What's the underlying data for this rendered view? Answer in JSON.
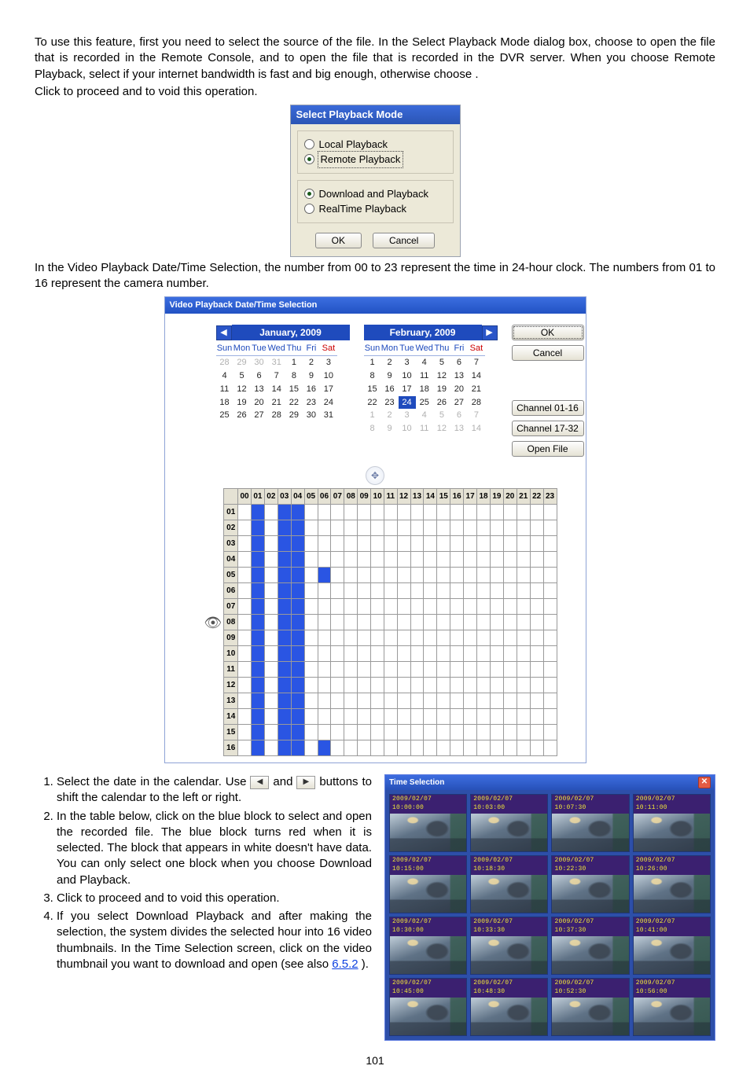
{
  "intro": {
    "p1a": "To use this feature, first you need to select the source of the file. In the Select Playback Mode dialog box, choose ",
    "p1b": " to open the file that is recorded in the Remote Console, and ",
    "p1c": " to open the file that is recorded in the DVR server. When you choose Remote Playback, select ",
    "p1d": " if your internet bandwidth is fast and big enough, otherwise choose ",
    "p1e": ".",
    "p2a": "Click ",
    "p2b": " to proceed and ",
    "p2c": " to void this operation."
  },
  "spm": {
    "title": "Select Playback Mode",
    "opt1": "Local Playback",
    "opt2": "Remote Playback",
    "opt3": "Download and Playback",
    "opt4": "RealTime Playback",
    "ok": "OK",
    "cancel": "Cancel"
  },
  "mid": {
    "p": "In the Video Playback Date/Time Selection, the number from 00 to 23 represent the time in 24-hour clock. The numbers from 01 to 16 represent the camera number."
  },
  "vpd": {
    "title": "Video Playback Date/Time Selection",
    "ok": "OK",
    "cancel": "Cancel",
    "ch1": "Channel 01-16",
    "ch2": "Channel 17-32",
    "open": "Open File",
    "months": [
      {
        "label": "January, 2009",
        "dow": [
          "Sun",
          "Mon",
          "Tue",
          "Wed",
          "Thu",
          "Fri",
          "Sat"
        ],
        "weeks": [
          [
            {
              "d": 28,
              "dim": true
            },
            {
              "d": 29,
              "dim": true
            },
            {
              "d": 30,
              "dim": true
            },
            {
              "d": 31,
              "dim": true
            },
            {
              "d": 1
            },
            {
              "d": 2
            },
            {
              "d": 3
            }
          ],
          [
            {
              "d": 4
            },
            {
              "d": 5
            },
            {
              "d": 6
            },
            {
              "d": 7
            },
            {
              "d": 8
            },
            {
              "d": 9
            },
            {
              "d": 10
            }
          ],
          [
            {
              "d": 11
            },
            {
              "d": 12
            },
            {
              "d": 13
            },
            {
              "d": 14
            },
            {
              "d": 15
            },
            {
              "d": 16
            },
            {
              "d": 17
            }
          ],
          [
            {
              "d": 18
            },
            {
              "d": 19
            },
            {
              "d": 20
            },
            {
              "d": 21
            },
            {
              "d": 22
            },
            {
              "d": 23
            },
            {
              "d": 24
            }
          ],
          [
            {
              "d": 25
            },
            {
              "d": 26
            },
            {
              "d": 27
            },
            {
              "d": 28
            },
            {
              "d": 29
            },
            {
              "d": 30
            },
            {
              "d": 31
            }
          ]
        ]
      },
      {
        "label": "February, 2009",
        "dow": [
          "Sun",
          "Mon",
          "Tue",
          "Wed",
          "Thu",
          "Fri",
          "Sat"
        ],
        "weeks": [
          [
            {
              "d": 1
            },
            {
              "d": 2
            },
            {
              "d": 3
            },
            {
              "d": 4
            },
            {
              "d": 5
            },
            {
              "d": 6
            },
            {
              "d": 7
            }
          ],
          [
            {
              "d": 8
            },
            {
              "d": 9
            },
            {
              "d": 10
            },
            {
              "d": 11
            },
            {
              "d": 12
            },
            {
              "d": 13
            },
            {
              "d": 14
            }
          ],
          [
            {
              "d": 15
            },
            {
              "d": 16
            },
            {
              "d": 17
            },
            {
              "d": 18
            },
            {
              "d": 19
            },
            {
              "d": 20
            },
            {
              "d": 21
            }
          ],
          [
            {
              "d": 22
            },
            {
              "d": 23
            },
            {
              "d": 24,
              "sel": true
            },
            {
              "d": 25
            },
            {
              "d": 26
            },
            {
              "d": 27
            },
            {
              "d": 28
            }
          ],
          [
            {
              "d": 1,
              "dim": true
            },
            {
              "d": 2,
              "dim": true
            },
            {
              "d": 3,
              "dim": true
            },
            {
              "d": 4,
              "dim": true
            },
            {
              "d": 5,
              "dim": true
            },
            {
              "d": 6,
              "dim": true
            },
            {
              "d": 7,
              "dim": true
            }
          ],
          [
            {
              "d": 8,
              "dim": true
            },
            {
              "d": 9,
              "dim": true
            },
            {
              "d": 10,
              "dim": true
            },
            {
              "d": 11,
              "dim": true
            },
            {
              "d": 12,
              "dim": true
            },
            {
              "d": 13,
              "dim": true
            },
            {
              "d": 14,
              "dim": true
            }
          ]
        ]
      }
    ],
    "hours": [
      "00",
      "01",
      "02",
      "03",
      "04",
      "05",
      "06",
      "07",
      "08",
      "09",
      "10",
      "11",
      "12",
      "13",
      "14",
      "15",
      "16",
      "17",
      "18",
      "19",
      "20",
      "21",
      "22",
      "23"
    ],
    "rows": [
      "01",
      "02",
      "03",
      "04",
      "05",
      "06",
      "07",
      "08",
      "09",
      "10",
      "11",
      "12",
      "13",
      "14",
      "15",
      "16"
    ],
    "on_cells": {
      "01": [
        1,
        3,
        4
      ],
      "02": [
        1,
        3,
        4
      ],
      "03": [
        1,
        3,
        4
      ],
      "04": [
        1,
        3,
        4
      ],
      "05": [
        1,
        3,
        4,
        6
      ],
      "06": [
        1,
        3,
        4
      ],
      "07": [
        1,
        3,
        4
      ],
      "08": [
        1,
        3,
        4
      ],
      "09": [
        1,
        3,
        4
      ],
      "10": [
        1,
        3,
        4
      ],
      "11": [
        1,
        3,
        4
      ],
      "12": [
        1,
        3,
        4
      ],
      "13": [
        1,
        3,
        4
      ],
      "14": [
        1,
        3,
        4
      ],
      "15": [
        1,
        3,
        4
      ],
      "16": [
        1,
        3,
        4,
        6
      ]
    }
  },
  "steps": {
    "s1a": "Select the date in the calendar. Use ",
    "s1b": " and ",
    "s1c": " buttons to shift the calendar to the left or right.",
    "s2": "In the table below, click on the blue block to select and open the recorded file. The blue block turns red when it is selected. The block that appears in white doesn't have data. You can only select one block when you choose Download and Playback.",
    "s3a": "Click ",
    "s3b": " to proceed and ",
    "s3c": " to void this operation.",
    "s4a": "If you select Download Playback and after making the selection, the system divides the selected hour into 16 video thumbnails. In the Time Selection screen, click on the video thumbnail you want to download and open (see also ",
    "s4link": "6.5.2",
    "s4b": ")."
  },
  "timesel": {
    "title": "Time Selection",
    "times": [
      "2009/02/07 10:00:00",
      "2009/02/07 10:03:00",
      "2009/02/07 10:07:30",
      "2009/02/07 10:11:00",
      "2009/02/07 10:15:00",
      "2009/02/07 10:18:30",
      "2009/02/07 10:22:30",
      "2009/02/07 10:26:00",
      "2009/02/07 10:30:00",
      "2009/02/07 10:33:30",
      "2009/02/07 10:37:30",
      "2009/02/07 10:41:00",
      "2009/02/07 10:45:00",
      "2009/02/07 10:48:30",
      "2009/02/07 10:52:30",
      "2009/02/07 10:56:00"
    ]
  },
  "page": "101"
}
